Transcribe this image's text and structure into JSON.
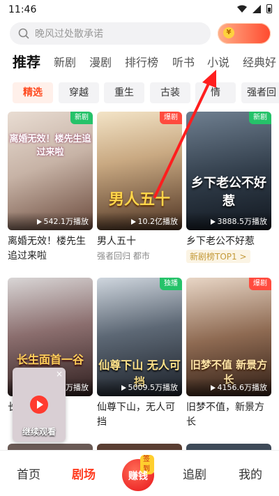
{
  "status": {
    "time": "11:46"
  },
  "search": {
    "placeholder": "晚风过处散承诺"
  },
  "coin": {
    "symbol": "¥"
  },
  "tabs": [
    "推荐",
    "新剧",
    "漫剧",
    "排行榜",
    "听书",
    "小说",
    "经典好"
  ],
  "chips": [
    "精选",
    "穿越",
    "重生",
    "古装",
    "情",
    "强者回"
  ],
  "cards": [
    {
      "poster_text": "离婚无效！楼先生追过来啦",
      "badge": "新剧",
      "plays": "542.1万播放",
      "title": "离婚无效！楼先生追过来啦",
      "subtitle": ""
    },
    {
      "poster_text": "男人五十",
      "badge": "爆剧",
      "plays": "10.2亿播放",
      "title": "男人五十",
      "subtitle": "强者回归 都市"
    },
    {
      "poster_text": "乡下老公不好惹",
      "badge": "新剧",
      "plays": "3888.5万播放",
      "title": "乡下老公不好惹",
      "subtitle": "新剧榜TOP1 >"
    },
    {
      "poster_text": "长生面首一谷",
      "badge": "",
      "plays": "万播放",
      "title": "长 女帝求我",
      "subtitle": ""
    },
    {
      "poster_text": "仙尊下山 无人可挡",
      "badge": "独播",
      "plays": "5009.5万播放",
      "title": "仙尊下山，无人可挡",
      "subtitle": ""
    },
    {
      "poster_text": "旧梦不值 新景方长",
      "badge": "爆剧",
      "plays": "4156.6万播放",
      "title": "旧梦不值，新景方长",
      "subtitle": ""
    }
  ],
  "mini_player": {
    "label": "继续观看",
    "close": "×"
  },
  "bottom_nav": {
    "home": "首页",
    "theater": "剧场",
    "earn": "赚钱",
    "earn_tag": "签到",
    "follow": "追剧",
    "me": "我的"
  },
  "colors": {
    "accent": "#ff3b1f",
    "badge_red": "#ff4b3e",
    "badge_green": "#25c269",
    "arrow": "#ff1e1e"
  }
}
